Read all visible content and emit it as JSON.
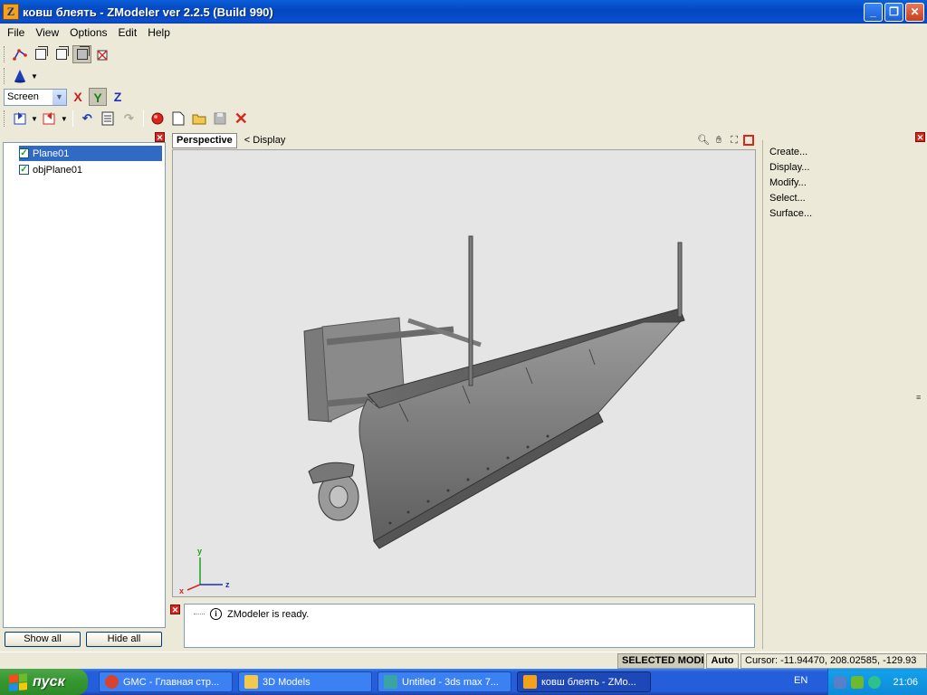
{
  "window": {
    "title": "ковш блеять - ZModeler ver 2.2.5 (Build 990)",
    "app_icon": "Z"
  },
  "menu": [
    "File",
    "View",
    "Options",
    "Edit",
    "Help"
  ],
  "toolbar": {
    "coord_system": "Screen",
    "axis_x": "X",
    "axis_y": "Y",
    "axis_z": "Z"
  },
  "scene_tree": {
    "items": [
      {
        "label": "Plane01",
        "checked": true,
        "selected": true
      },
      {
        "label": "objPlane01",
        "checked": true,
        "selected": false
      }
    ],
    "show_all": "Show all",
    "hide_all": "Hide all"
  },
  "viewport": {
    "tab": "Perspective",
    "display_link": "< Display",
    "gizmo": {
      "y": "y",
      "x": "x",
      "z": "z"
    },
    "background": "#e5e5e5"
  },
  "log": {
    "message": "ZModeler is ready."
  },
  "commands": [
    "Create...",
    "Display...",
    "Modify...",
    "Select...",
    "Surface..."
  ],
  "status": {
    "mode": "SELECTED MODE",
    "auto": "Auto",
    "cursor": "Cursor: -11.94470, 208.02585, -129.93"
  },
  "taskbar": {
    "start": "пуск",
    "tasks": [
      {
        "label": "GMC - Главная стр...",
        "icon": "chrome-icon",
        "color": "#d9422d"
      },
      {
        "label": "3D Models",
        "icon": "folder-icon",
        "color": "#f2c94c"
      },
      {
        "label": "Untitled - 3ds max 7...",
        "icon": "3dsmax-icon",
        "color": "#3aa3a3"
      },
      {
        "label": "ковш блеять - ZMo...",
        "icon": "zmodeler-icon",
        "color": "#f3a21b"
      }
    ],
    "lang": "EN",
    "clock": "21:06"
  }
}
